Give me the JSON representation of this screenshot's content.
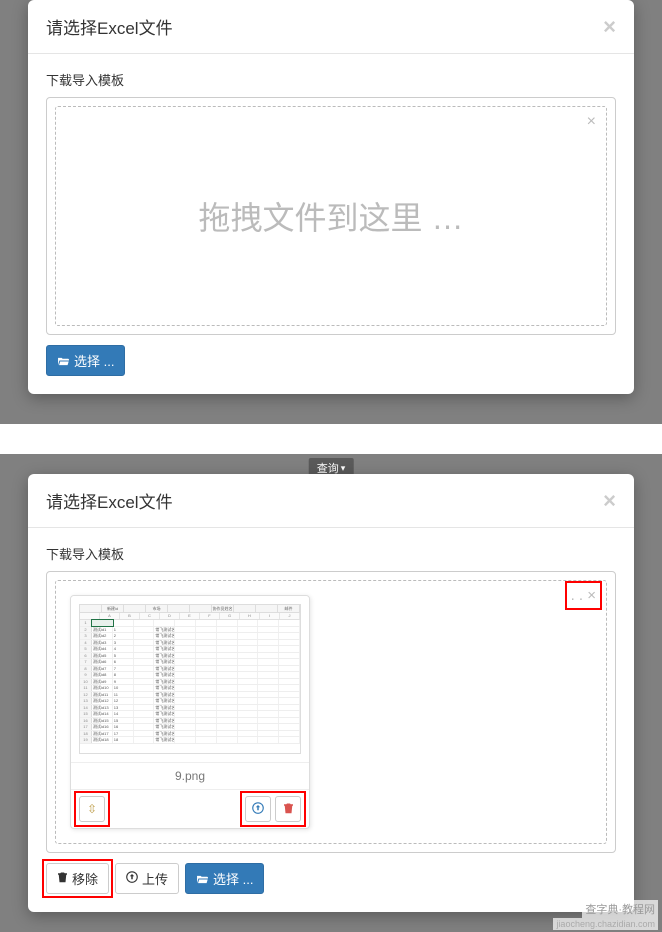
{
  "modal1": {
    "title": "请选择Excel文件",
    "template_link": "下载导入模板",
    "drop_text": "拖拽文件到这里 …",
    "select_btn": "选择 ..."
  },
  "modal2": {
    "behind_label": "查询",
    "title": "请选择Excel文件",
    "template_link": "下载导入模板",
    "file_name": "9.png",
    "remove_btn": "移除",
    "upload_btn": "上传",
    "select_btn": "选择 ...",
    "spreadsheet": {
      "top_headers": [
        "",
        "新建id",
        "",
        "市场",
        "",
        "",
        "协作员姓名",
        "",
        "",
        "邮件"
      ],
      "col_letters": [
        "",
        "A",
        "B",
        "C",
        "D",
        "E",
        "F",
        "G",
        "H",
        "I",
        "J"
      ],
      "rows": [
        {
          "n": "1",
          "cells": [
            "",
            "",
            "",
            "",
            "",
            "",
            "",
            "",
            "",
            ""
          ]
        },
        {
          "n": "2",
          "cells": [
            "测试id1",
            "1",
            "",
            "常飞测试名称",
            "",
            "",
            "",
            "",
            "",
            ""
          ]
        },
        {
          "n": "3",
          "cells": [
            "测试id2",
            "2",
            "",
            "常飞测试名称",
            "",
            "",
            "",
            "",
            "",
            ""
          ]
        },
        {
          "n": "4",
          "cells": [
            "测试id3",
            "3",
            "",
            "常飞测试名称",
            "",
            "",
            "",
            "",
            "",
            ""
          ]
        },
        {
          "n": "5",
          "cells": [
            "测试id4",
            "4",
            "",
            "常飞测试名称",
            "",
            "",
            "",
            "",
            "",
            ""
          ]
        },
        {
          "n": "6",
          "cells": [
            "测试id5",
            "5",
            "",
            "常飞测试名称",
            "",
            "",
            "",
            "",
            "",
            ""
          ]
        },
        {
          "n": "7",
          "cells": [
            "测试id6",
            "6",
            "",
            "常飞测试名称",
            "",
            "",
            "",
            "",
            "",
            ""
          ]
        },
        {
          "n": "8",
          "cells": [
            "测试id7",
            "7",
            "",
            "常飞测试名称",
            "",
            "",
            "",
            "",
            "",
            ""
          ]
        },
        {
          "n": "9",
          "cells": [
            "测试id8",
            "8",
            "",
            "常飞测试名称",
            "",
            "",
            "",
            "",
            "",
            ""
          ]
        },
        {
          "n": "10",
          "cells": [
            "测试id9",
            "9",
            "",
            "常飞测试名称",
            "",
            "",
            "",
            "",
            "",
            ""
          ]
        },
        {
          "n": "11",
          "cells": [
            "测试id10",
            "10",
            "",
            "常飞测试名称",
            "",
            "",
            "",
            "",
            "",
            ""
          ]
        },
        {
          "n": "12",
          "cells": [
            "测试id11",
            "11",
            "",
            "常飞测试名称",
            "",
            "",
            "",
            "",
            "",
            ""
          ]
        },
        {
          "n": "13",
          "cells": [
            "测试id12",
            "12",
            "",
            "常飞测试名称",
            "",
            "",
            "",
            "",
            "",
            ""
          ]
        },
        {
          "n": "14",
          "cells": [
            "测试id13",
            "13",
            "",
            "常飞测试名称",
            "",
            "",
            "",
            "",
            "",
            ""
          ]
        },
        {
          "n": "15",
          "cells": [
            "测试id14",
            "14",
            "",
            "常飞测试名称",
            "",
            "",
            "",
            "",
            "",
            ""
          ]
        },
        {
          "n": "16",
          "cells": [
            "测试id15",
            "15",
            "",
            "常飞测试名称",
            "",
            "",
            "",
            "",
            "",
            ""
          ]
        },
        {
          "n": "17",
          "cells": [
            "测试id16",
            "16",
            "",
            "常飞测试名称",
            "",
            "",
            "",
            "",
            "",
            ""
          ]
        },
        {
          "n": "18",
          "cells": [
            "测试id17",
            "17",
            "",
            "常飞测试名称",
            "",
            "",
            "",
            "",
            "",
            ""
          ]
        },
        {
          "n": "19",
          "cells": [
            "测试id18",
            "18",
            "",
            "常飞测试名称",
            "",
            "",
            "",
            "",
            "",
            ""
          ]
        }
      ]
    }
  },
  "watermark": {
    "cn": "查字典·教程网",
    "url": "jiaocheng.chazidian.com"
  }
}
